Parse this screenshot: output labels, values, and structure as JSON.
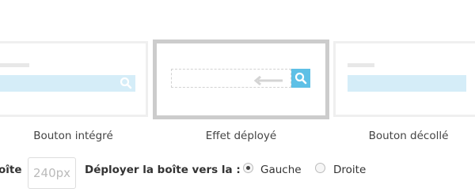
{
  "options": [
    {
      "id": "integre",
      "caption": "Bouton intégré",
      "selected": false
    },
    {
      "id": "deploye",
      "caption": "Effet déployé",
      "selected": true
    },
    {
      "id": "decolle",
      "caption": "Bouton décollé",
      "selected": false
    }
  ],
  "width_field": {
    "label_fragment": "oîte",
    "placeholder": "240px"
  },
  "deploy_direction": {
    "label": "Déployer la boîte vers la :",
    "choices": [
      {
        "label": "Gauche",
        "checked": true
      },
      {
        "label": "Droite",
        "checked": false
      }
    ]
  },
  "colors": {
    "accent": "#5ec0e6",
    "bar": "#d5edf8",
    "selected_border": "#cccccc"
  },
  "icons": {
    "search": "search-icon",
    "arrow": "arrow-left-icon"
  }
}
